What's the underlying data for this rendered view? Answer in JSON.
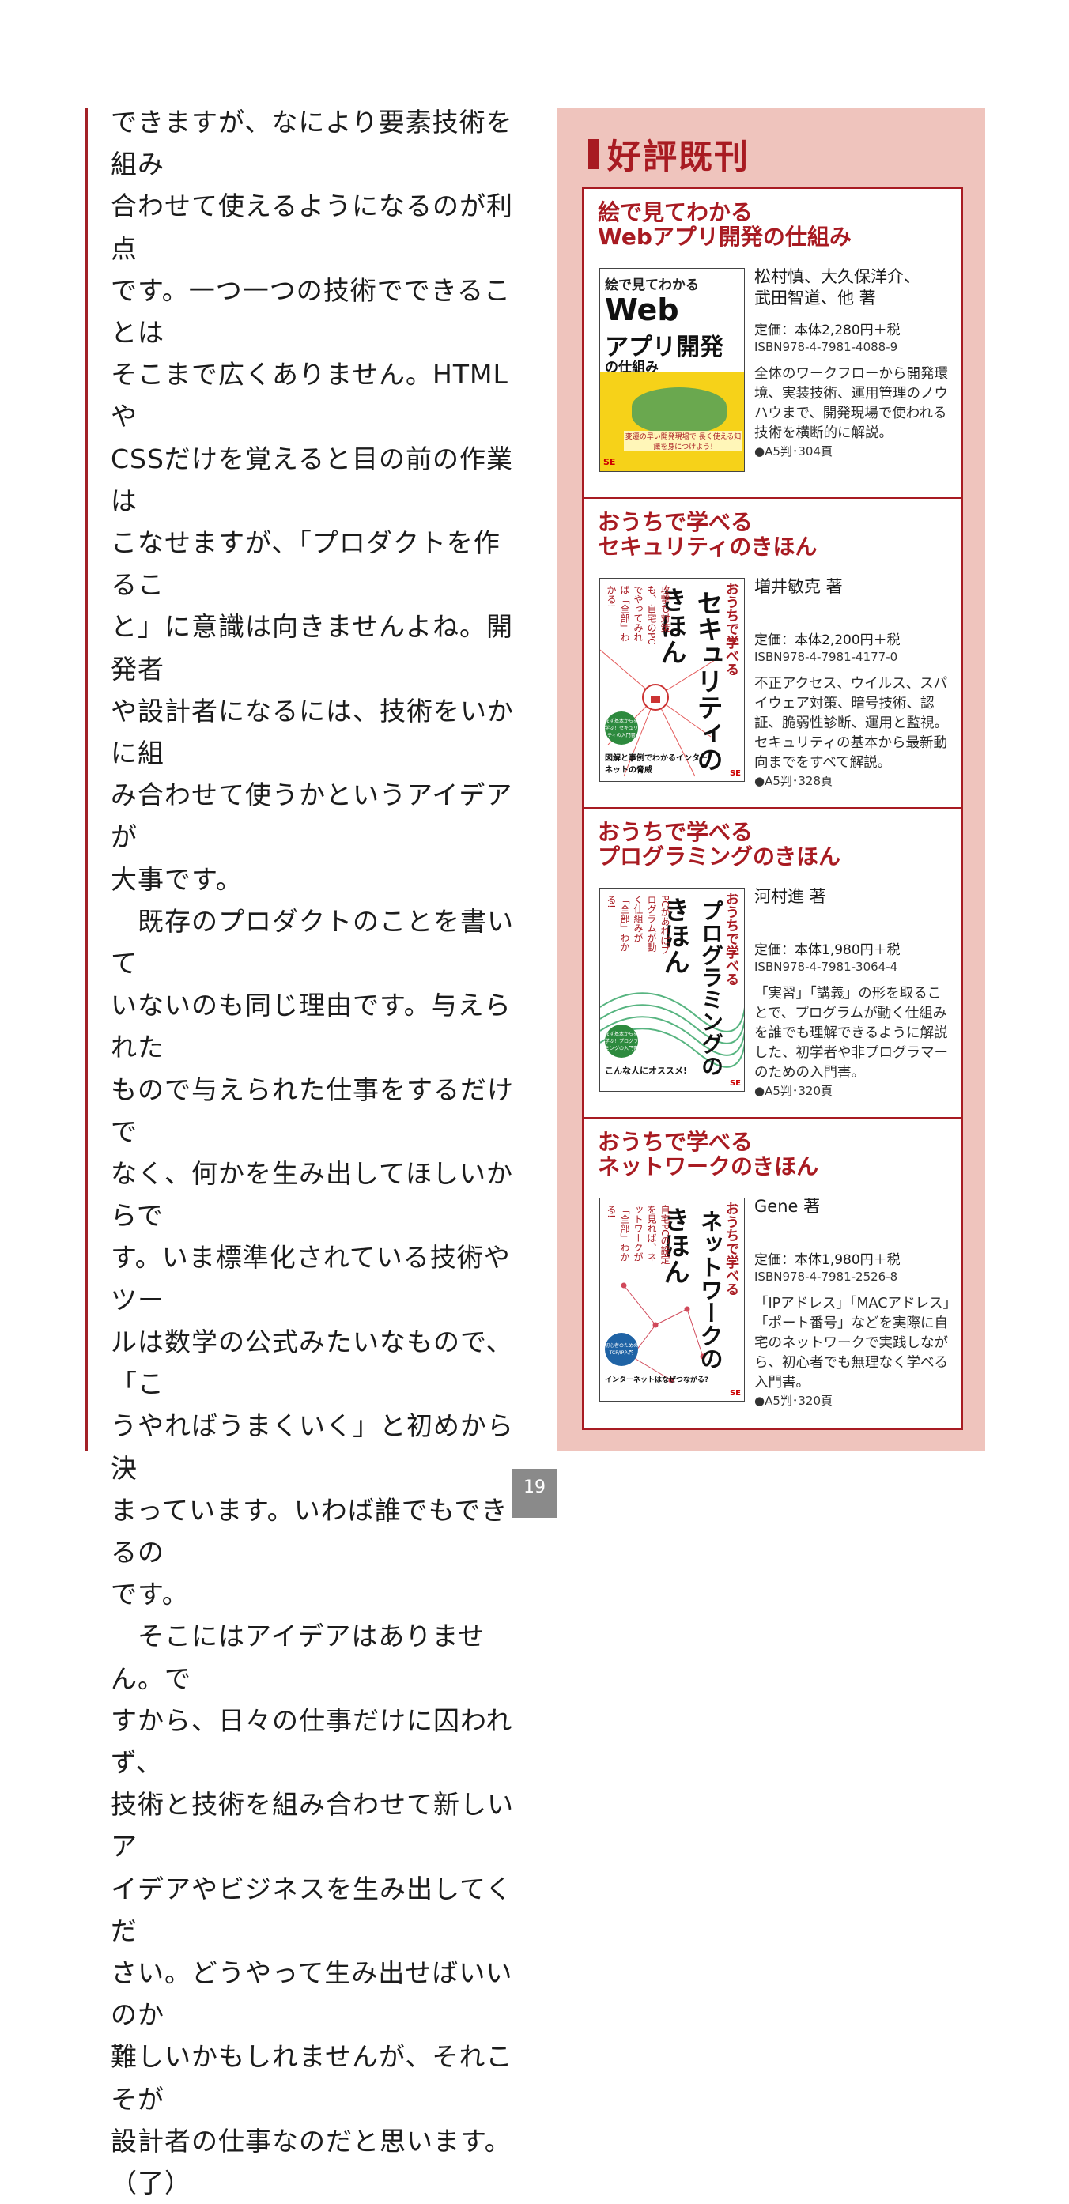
{
  "left_column": {
    "paragraph_text": "できますが、なにより要素技術を組み\n合わせて使えるようになるのが利点\nです。一つ一つの技術でできることは\nそこまで広くありません。HTMLや\nCSSだけを覚えると目の前の作業は\nこなせますが、「プロダクトを作るこ\nと」に意識は向きませんよね。開発者\nや設計者になるには、技術をいかに組\nみ合わせて使うかというアイデアが\n大事です。\n　既存のプロダクトのことを書いて\nいないのも同じ理由です。与えられた\nもので与えられた仕事をするだけで\nなく、何かを生み出してほしいからで\nす。いま標準化されている技術やツー\nルは数学の公式みたいなもので、「こ\nうやればうまくいく」と初めから決\nまっています。いわば誰でもできるの\nです。\n　そこにはアイデアはありません。で\nすから、日々の仕事だけに囚われず、\n技術と技術を組み合わせて新しいア\nイデアやビジネスを生み出してくだ\nさい。どうやって生み出せばいいのか\n難しいかもしれませんが、それこそが\n設計者の仕事なのだと思います。（了）"
  },
  "panel": {
    "heading": "好評既刊",
    "books": [
      {
        "title": "絵で見てわかる\nWebアプリ開発の仕組み",
        "author": "松村慎、大久保洋介、\n武田智道、他 著",
        "price": "定価：本体2,280円＋税",
        "isbn": "ISBN978-4-7981-4088-9",
        "description": "全体のワークフローから開発環境、実装技術、運用管理のノウハウまで、開発現場で使われる技術を横断的に解説。",
        "spec": "●A5判･304頁",
        "cover": {
          "ribbon": "絵で見てわかる",
          "big": "Web",
          "mid": "アプリ開発",
          "sub": "の仕組み",
          "caption": "変遷の早い開発現場で 長く使える知識を身につけよう!",
          "publisher": "SE"
        }
      },
      {
        "title": "おうちで学べる\nセキュリティのきほん",
        "author": "増井敏克 著",
        "price": "定価：本体2,200円＋税",
        "isbn": "ISBN978-4-7981-4177-0",
        "description": "不正アクセス、ウイルス、スパイウェア対策、暗号技術、認証、脆弱性診断、運用と監視。セキュリティの基本から最新動向までをすべて解説。",
        "spec": "●A5判･328頁",
        "cover": {
          "prefix": "おうちで学べる",
          "main": "セキュリティの",
          "sub": "きほん",
          "side": "攻撃も対策も、自宅のPCでやってみれば「全部」わかる!",
          "badge": "まず基本からを学ぶ！セキュリティの入門書",
          "tag": "図解と事例でわかるインターネットの脅威",
          "publisher": "SE"
        }
      },
      {
        "title": "おうちで学べる\nプログラミングのきほん",
        "author": "河村進 著",
        "price": "定価：本体1,980円＋税",
        "isbn": "ISBN978-4-7981-3064-4",
        "description": "「実習」「講義」の形を取ることで、プログラムが動く仕組みを誰でも理解できるように解説した、初学者や非プログラマーのための入門書。",
        "spec": "●A5判･320頁",
        "cover": {
          "prefix": "おうちで学べる",
          "main": "プログラミングの",
          "sub": "きほん",
          "side": "PCがあればプログラムが動く仕組みが「全部」わかる!",
          "badge": "まず基本からを学ぶ！プログラミングの入門書",
          "tag": "こんな人にオススメ!",
          "publisher": "SE"
        }
      },
      {
        "title": "おうちで学べる\nネットワークのきほん",
        "author": "Gene 著",
        "price": "定価：本体1,980円＋税",
        "isbn": "ISBN978-4-7981-2526-8",
        "description": "「IPアドレス」「MACアドレス」「ポート番号」などを実際に自宅のネットワークで実践しながら、初心者でも無理なく学べる入門書。",
        "spec": "●A5判･320頁",
        "cover": {
          "prefix": "おうちで学べる",
          "main": "ネットワークの",
          "sub": "きほん",
          "side": "自宅PCの設定を見れば、ネットワークが「全部」わかる!",
          "badge": "初心者のためのTCP/IP入門",
          "tag": "インターネットはなぜつながる?",
          "publisher": "SE"
        }
      }
    ]
  },
  "footer": {
    "page_number": "19"
  },
  "colors": {
    "accent": "#a81b22",
    "panel_bg": "#efc4bd",
    "page_tab": "#8a8a8a"
  }
}
